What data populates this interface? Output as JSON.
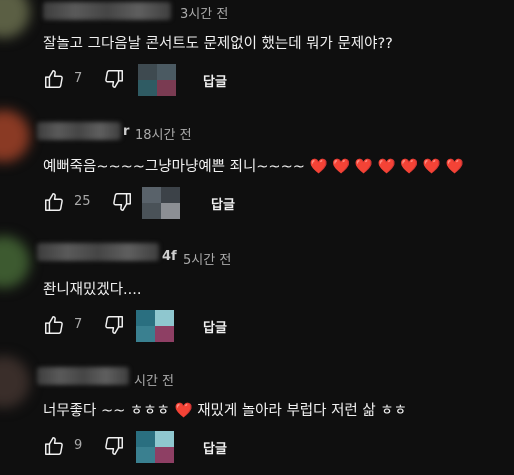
{
  "colors": {
    "background": "#0f0f0f",
    "text": "#f1f1f1",
    "secondary": "#aaaaaa",
    "heart": "#e53935"
  },
  "icons": {
    "like": "thumb-up-outline-icon",
    "dislike": "thumb-down-outline-icon",
    "heart": "red-heart-emoji"
  },
  "comments": [
    {
      "username_suffix": "",
      "timestamp": "3시간 전",
      "text": "잘놀고 그다음날 콘서트도 문제없이 했는데 뭐가 문제야??",
      "hearts": "",
      "text_after": "",
      "likes": "7",
      "reply_label": "답글"
    },
    {
      "username_suffix": "r",
      "timestamp": "18시간 전",
      "text": "예뻐죽음~~~~그냥마냥예쁜 죄니~~~~",
      "hearts": "❤️ ❤️ ❤️ ❤️ ❤️ ❤️ ❤️",
      "text_after": "",
      "likes": "25",
      "reply_label": "답글"
    },
    {
      "username_suffix": "4f",
      "timestamp": "5시간 전",
      "text": "좐니재밌겠다....",
      "hearts": "",
      "text_after": "",
      "likes": "7",
      "reply_label": "답글"
    },
    {
      "username_suffix": "",
      "timestamp": "시간 전",
      "text": "너무좋다 ~~ ㅎㅎㅎ",
      "hearts": "❤️",
      "text_after": "재밌게 놀아라 부럽다 저런 삶 ㅎㅎ",
      "likes": "9",
      "reply_label": "답글"
    }
  ]
}
